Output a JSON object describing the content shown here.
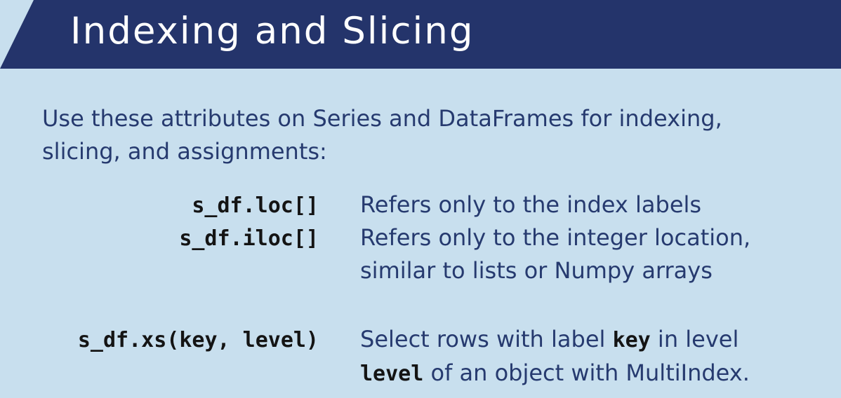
{
  "slide": {
    "title": "Indexing and Slicing",
    "intro_line1": "Use these attributes on Series and DataFrames for indexing,",
    "intro_line2": "slicing, and assignments:"
  },
  "rows": [
    {
      "code": "s_df.loc[]",
      "desc_line1": "Refers only to the index labels"
    },
    {
      "code": "s_df.iloc[]",
      "desc_line1": "Refers only to the integer location,",
      "desc_line2": "similar to lists or Numpy arrays"
    },
    {
      "code": "s_df.xs(key, level)",
      "desc_line1_pre": "Select rows with label ",
      "desc_line1_kw": "key",
      "desc_line1_post": " in level",
      "desc_line2_kw": "level",
      "desc_line2_post": " of an object with MultiIndex."
    }
  ],
  "colors": {
    "banner": "#24346b",
    "background": "#c8dfee",
    "text": "#263a6f",
    "code": "#141414"
  }
}
